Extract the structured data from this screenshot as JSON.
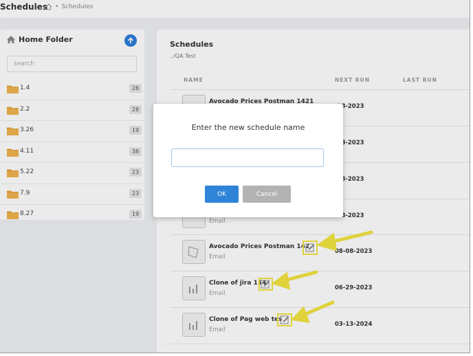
{
  "header": {
    "title": "Schedules",
    "breadcrumb": "Schedules"
  },
  "sidebar": {
    "title": "Home Folder",
    "search_placeholder": "search",
    "folders": [
      {
        "name": "1.4",
        "count": "28"
      },
      {
        "name": "2.2",
        "count": "28"
      },
      {
        "name": "3.26",
        "count": "19"
      },
      {
        "name": "4.11",
        "count": "38"
      },
      {
        "name": "5.22",
        "count": "23"
      },
      {
        "name": "7.9",
        "count": "23"
      },
      {
        "name": "8.27",
        "count": "19"
      }
    ]
  },
  "main": {
    "title": "Schedules",
    "path": "../QA Test",
    "columns": {
      "name": "NAME",
      "next_run": "NEXT RUN",
      "last_run": "LAST RUN"
    },
    "rows": [
      {
        "name": "Avocado Prices Postman 1421",
        "type": "",
        "next_run": "-08-2023"
      },
      {
        "name": "",
        "type": "",
        "next_run": "-08-2023"
      },
      {
        "name": "",
        "type": "",
        "next_run": "-08-2023"
      },
      {
        "name": "",
        "type": "Email",
        "next_run": "-08-2023"
      },
      {
        "name": "Avocado Prices Postman 142",
        "type": "Email",
        "next_run": "08-08-2023"
      },
      {
        "name": "Clone of jira 114",
        "type": "Email",
        "next_run": "06-29-2023"
      },
      {
        "name": "Clone of Pag web tes",
        "type": "Email",
        "next_run": "03-13-2024"
      }
    ]
  },
  "modal": {
    "title": "Enter the new schedule name",
    "input_value": "",
    "ok_label": "OK",
    "cancel_label": "Cancel"
  },
  "colors": {
    "accent": "#2f84d8",
    "highlight": "#f2e441",
    "folder": "#e8a33a"
  }
}
